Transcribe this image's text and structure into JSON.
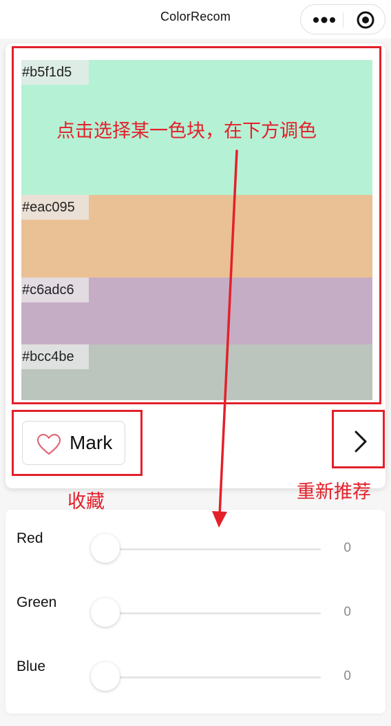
{
  "navbar": {
    "title": "ColorRecom",
    "more_icon": "more-dots-icon",
    "close_icon": "target-close-icon"
  },
  "palette": {
    "swatches": [
      {
        "hex": "#b5f1d5",
        "label": "#b5f1d5"
      },
      {
        "hex": "#eac095",
        "label": "#eac095"
      },
      {
        "hex": "#c6adc6",
        "label": "#c6adc6"
      },
      {
        "hex": "#bcc4be",
        "label": "#bcc4be"
      }
    ]
  },
  "actions": {
    "mark_label": "Mark",
    "mark_icon": "heart-outline-icon",
    "next_icon": "chevron-right-icon"
  },
  "annotations": {
    "palette_hint": "点击选择某一色块，在下方调色",
    "mark_hint": "收藏",
    "next_hint": "重新推荐",
    "color": "#e3202a"
  },
  "rgb": {
    "sliders": [
      {
        "label": "Red",
        "value": "0"
      },
      {
        "label": "Green",
        "value": "0"
      },
      {
        "label": "Blue",
        "value": "0"
      }
    ]
  }
}
